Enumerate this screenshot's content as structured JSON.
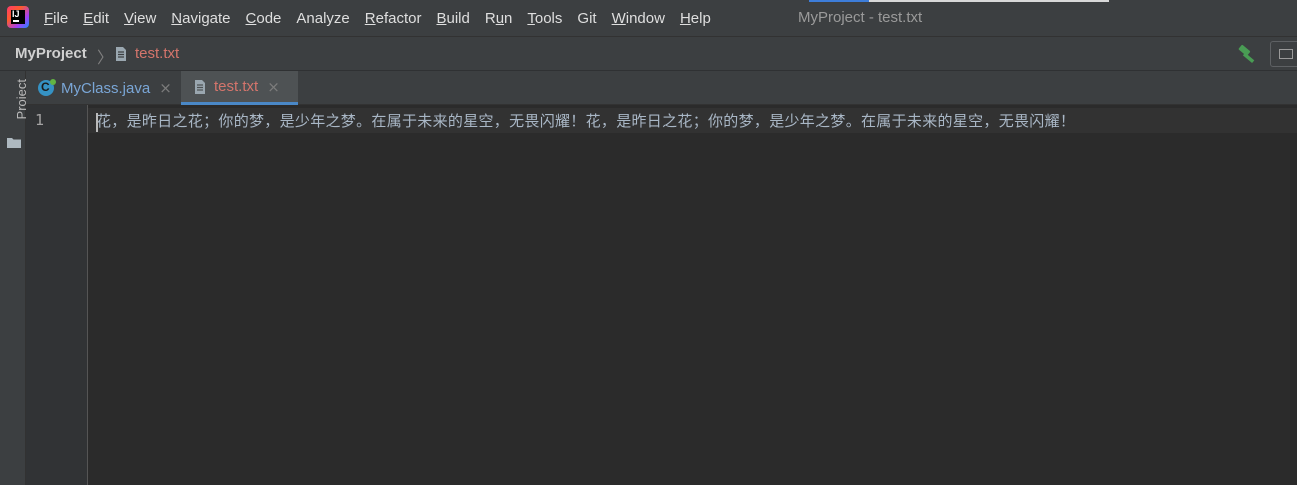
{
  "app": {
    "logo_text": "IJ",
    "window_title": "MyProject - test.txt"
  },
  "menu": [
    {
      "mnemonic": "F",
      "rest": "ile"
    },
    {
      "mnemonic": "E",
      "rest": "dit"
    },
    {
      "mnemonic": "V",
      "rest": "iew"
    },
    {
      "mnemonic": "N",
      "rest": "avigate"
    },
    {
      "mnemonic": "C",
      "rest": "ode"
    },
    {
      "mnemonic": "",
      "rest": "Analyze"
    },
    {
      "mnemonic": "R",
      "rest": "efactor"
    },
    {
      "mnemonic": "B",
      "rest": "uild"
    },
    {
      "pre": "R",
      "mnemonic": "u",
      "rest": "n"
    },
    {
      "mnemonic": "T",
      "rest": "ools"
    },
    {
      "mnemonic": "",
      "rest": "Git"
    },
    {
      "mnemonic": "W",
      "rest": "indow"
    },
    {
      "mnemonic": "H",
      "rest": "elp"
    }
  ],
  "navbar": {
    "project": "MyProject",
    "separator": "〉",
    "file": "test.txt",
    "file_icon": "text-file-icon",
    "build_icon": "hammer-icon"
  },
  "toolstrip": {
    "project_tab": "Project",
    "folder_icon": "folder-icon"
  },
  "tabs": [
    {
      "label": "MyClass.java",
      "icon": "java-class-icon",
      "close": "×",
      "active": false
    },
    {
      "label": "test.txt",
      "icon": "text-file-icon",
      "close": "×",
      "active": true
    }
  ],
  "editor": {
    "line_numbers": [
      "1"
    ],
    "lines": [
      "花，是昨日之花；你的梦，是少年之梦。在属于未来的星空，无畏闪耀！花，是昨日之花；你的梦，是少年之梦。在属于未来的星空，无畏闪耀！"
    ]
  },
  "colors": {
    "background": "#2b2b2b",
    "chrome": "#3c3f41",
    "active_tab": "#4e5254",
    "tab_underline": "#4a88c7",
    "modified_file_text": "#d5756c",
    "java_file_text": "#7aa6d6",
    "editor_text": "#a9b7c6",
    "build_icon": "#499c54"
  }
}
